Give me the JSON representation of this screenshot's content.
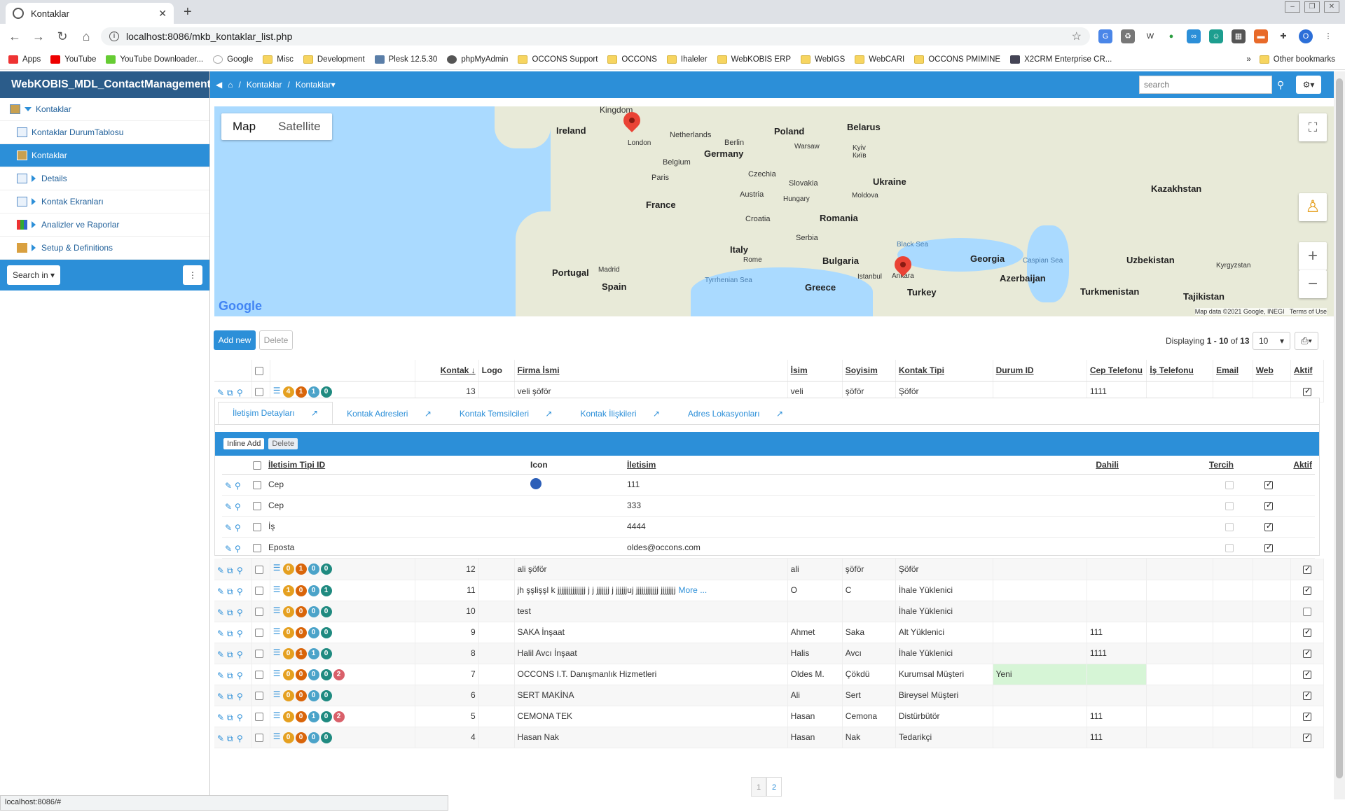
{
  "browser": {
    "tab_title": "Kontaklar",
    "url": "localhost:8086/mkb_kontaklar_list.php",
    "status_url": "localhost:8086/#"
  },
  "bookmarks": [
    "Apps",
    "YouTube",
    "YouTube Downloader...",
    "Google",
    "Misc",
    "Development",
    "Plesk 12.5.30",
    "phpMyAdmin",
    "OCCONS Support",
    "OCCONS",
    "Ihaleler",
    "WebKOBIS ERP",
    "WebIGS",
    "WebCARI",
    "OCCONS PMIMINE",
    "X2CRM Enterprise CR...",
    "Other bookmarks"
  ],
  "sidebar": {
    "title": "WebKOBIS_MDL_ContactManagement",
    "items": [
      {
        "label": "Kontaklar"
      },
      {
        "label": "Kontaklar DurumTablosu"
      },
      {
        "label": "Kontaklar"
      },
      {
        "label": "Details"
      },
      {
        "label": "Kontak Ekranları"
      },
      {
        "label": "Analizler ve Raporlar"
      },
      {
        "label": "Setup & Definitions"
      }
    ],
    "search_label": "Search in"
  },
  "topbar": {
    "crumb1": "Kontaklar",
    "crumb2": "Kontaklar",
    "search_placeholder": "search"
  },
  "map": {
    "type_map": "Map",
    "type_satellite": "Satellite",
    "attribution": "Map data ©2021 Google, INEGI",
    "terms": "Terms of Use",
    "brand": "Google",
    "labels": [
      "Kingdom",
      "Ireland",
      "London",
      "Netherlands",
      "Berlin",
      "Poland",
      "Belarus",
      "Germany",
      "Warsaw",
      "Kyiv",
      "Київ",
      "Belgium",
      "Paris",
      "Czechia",
      "Slovakia",
      "Ukraine",
      "Kazakhstan",
      "France",
      "Austria",
      "Hungary",
      "Moldova",
      "Croatia",
      "Romania",
      "Serbia",
      "Black Sea",
      "Georgia",
      "Italy",
      "Bulgaria",
      "Caspian Sea",
      "Uzbekistan",
      "Kyrgyzstan",
      "Portugal",
      "Madrid",
      "Rome",
      "Istanbul",
      "Ankara",
      "Azerbaijan",
      "Spain",
      "Tyrrhenian Sea",
      "Greece",
      "Turkey",
      "Turkmenistan",
      "Tajikistan"
    ]
  },
  "toolbar": {
    "add": "Add new",
    "delete": "Delete",
    "displaying_prefix": "Displaying",
    "displaying_from": "1",
    "displaying_sep": "-",
    "displaying_to": "10",
    "displaying_of": "of",
    "displaying_total": "13",
    "page_size": "10"
  },
  "columns": [
    "Kontak",
    "Logo",
    "Firma İsmi",
    "İsim",
    "Soyisim",
    "Kontak Tipi",
    "Durum ID",
    "Cep Telefonu",
    "İş Telefonu",
    "Email",
    "Web",
    "Aktif"
  ],
  "rows": [
    {
      "id": "13",
      "badges": [
        "4",
        "1",
        "1",
        "0"
      ],
      "firma": "veli şöför",
      "isim": "veli",
      "soyisim": "şöför",
      "tip": "Şöför",
      "durum": "",
      "cep": "1111",
      "aktif": true
    },
    {
      "id": "12",
      "badges": [
        "0",
        "1",
        "0",
        "0"
      ],
      "firma": "ali şöför",
      "isim": "ali",
      "soyisim": "şöför",
      "tip": "Şöför",
      "durum": "",
      "cep": "",
      "aktif": true
    },
    {
      "id": "11",
      "badges": [
        "1",
        "0",
        "0",
        "1"
      ],
      "firma": "jh şşlişşl k jjjjjjjjjjjjjjj j j jjjjjjj j jjjjjjuj jjjjjjjjjjjj jjjjjjjj",
      "more": "More ...",
      "isim": "O",
      "soyisim": "C",
      "tip": "İhale Yüklenici",
      "durum": "",
      "cep": "",
      "aktif": true
    },
    {
      "id": "10",
      "badges": [
        "0",
        "0",
        "0",
        "0"
      ],
      "firma": "test",
      "isim": "",
      "soyisim": "",
      "tip": "İhale Yüklenici",
      "durum": "",
      "cep": "",
      "aktif": false
    },
    {
      "id": "9",
      "badges": [
        "0",
        "0",
        "0",
        "0"
      ],
      "firma": "SAKA İnşaat",
      "isim": "Ahmet",
      "soyisim": "Saka",
      "tip": "Alt Yüklenici",
      "durum": "",
      "cep": "111",
      "aktif": true
    },
    {
      "id": "8",
      "badges": [
        "0",
        "1",
        "1",
        "0"
      ],
      "firma": "Halil Avcı İnşaat",
      "isim": "Halis",
      "soyisim": "Avcı",
      "tip": "İhale Yüklenici",
      "durum": "",
      "cep": "1111",
      "aktif": true
    },
    {
      "id": "7",
      "badges": [
        "0",
        "0",
        "0",
        "0",
        "2"
      ],
      "firma": "OCCONS I.T. Danışmanlık Hizmetleri",
      "isim": "Oldes M.",
      "soyisim": "Çökdü",
      "tip": "Kurumsal Müşteri",
      "durum": "Yeni",
      "cep": "",
      "aktif": true
    },
    {
      "id": "6",
      "badges": [
        "0",
        "0",
        "0",
        "0"
      ],
      "firma": "SERT MAKİNA",
      "isim": "Ali",
      "soyisim": "Sert",
      "tip": "Bireysel Müşteri",
      "durum": "",
      "cep": "",
      "aktif": true
    },
    {
      "id": "5",
      "badges": [
        "0",
        "0",
        "1",
        "0",
        "2"
      ],
      "firma": "CEMONA TEK",
      "isim": "Hasan",
      "soyisim": "Cemona",
      "tip": "Distürbütör",
      "durum": "",
      "cep": "111",
      "aktif": true
    },
    {
      "id": "4",
      "badges": [
        "0",
        "0",
        "0",
        "0"
      ],
      "firma": "Hasan Nak",
      "isim": "Hasan",
      "soyisim": "Nak",
      "tip": "Tedarikçi",
      "durum": "",
      "cep": "111",
      "aktif": true
    }
  ],
  "detail": {
    "tabs": [
      "İletişim Detayları",
      "Kontak Adresleri",
      "Kontak Temsilcileri",
      "Kontak İlişkileri",
      "Adres Lokasyonları"
    ],
    "inline_add": "Inline Add",
    "delete": "Delete",
    "columns": [
      "İletisim Tipi ID",
      "Icon",
      "İletisim",
      "Dahili",
      "Tercih",
      "Aktif"
    ],
    "rows": [
      {
        "tip": "Cep",
        "iletisim": "111",
        "icon": true
      },
      {
        "tip": "Cep",
        "iletisim": "333"
      },
      {
        "tip": "İş",
        "iletisim": "4444"
      },
      {
        "tip": "Eposta",
        "iletisim": "oldes@occons.com"
      }
    ]
  },
  "pager": [
    "1",
    "2"
  ]
}
